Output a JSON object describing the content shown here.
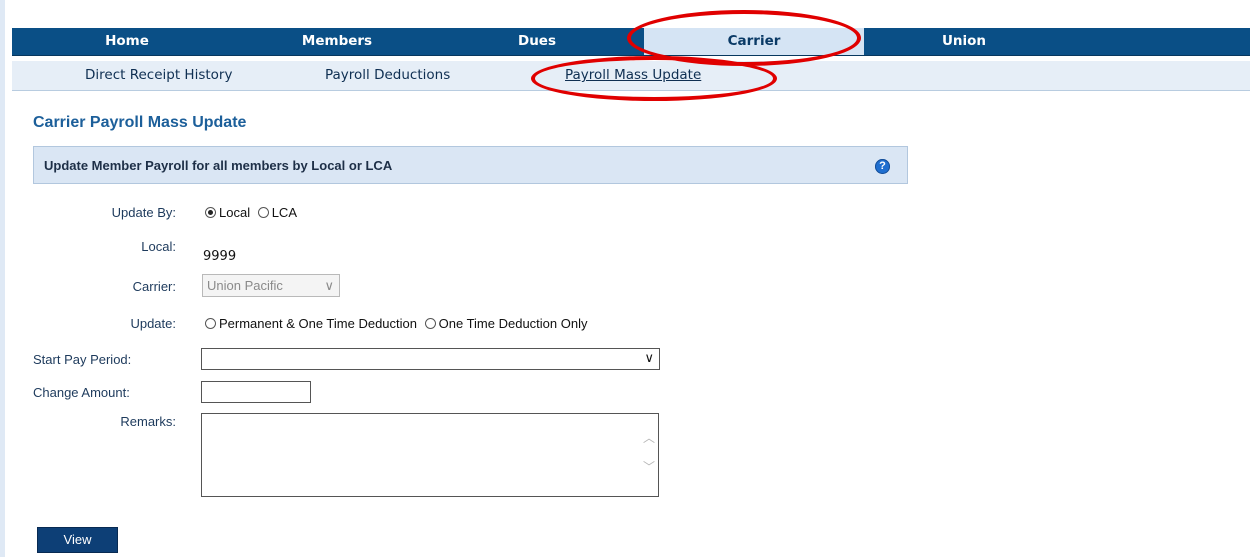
{
  "main_nav": {
    "tabs": [
      {
        "label": "Home"
      },
      {
        "label": "Members"
      },
      {
        "label": "Dues"
      },
      {
        "label": "Carrier"
      },
      {
        "label": "Union"
      }
    ]
  },
  "sub_nav": {
    "items": [
      {
        "label": "Direct Receipt History"
      },
      {
        "label": "Payroll Deductions"
      },
      {
        "label": "Payroll Mass Update"
      }
    ]
  },
  "page": {
    "title": "Carrier Payroll Mass Update",
    "section_header": "Update Member Payroll for all members by Local or LCA",
    "help_icon_glyph": "?"
  },
  "form": {
    "update_by": {
      "label": "Update By:",
      "options": [
        "Local",
        "LCA"
      ],
      "selected": "Local"
    },
    "local": {
      "label": "Local:",
      "value": "9999"
    },
    "carrier": {
      "label": "Carrier:",
      "value": "Union Pacific",
      "chevron": "∨"
    },
    "update": {
      "label": "Update:",
      "options": [
        "Permanent & One Time Deduction",
        "One Time Deduction Only"
      ]
    },
    "start_pay_period": {
      "label": "Start Pay Period:",
      "value": "",
      "chevron": "∨"
    },
    "change_amount": {
      "label": "Change Amount:",
      "value": ""
    },
    "remarks": {
      "label": "Remarks:",
      "value": "",
      "scroll_up": "︿",
      "scroll_down": "﹀"
    },
    "view_button": "View"
  },
  "colors": {
    "nav_bg": "#0a4f86",
    "active_tab_bg": "#d5e4f4",
    "annotation_ring": "#e00000",
    "title": "#1c5f9a",
    "button_bg": "#0d3f76"
  }
}
